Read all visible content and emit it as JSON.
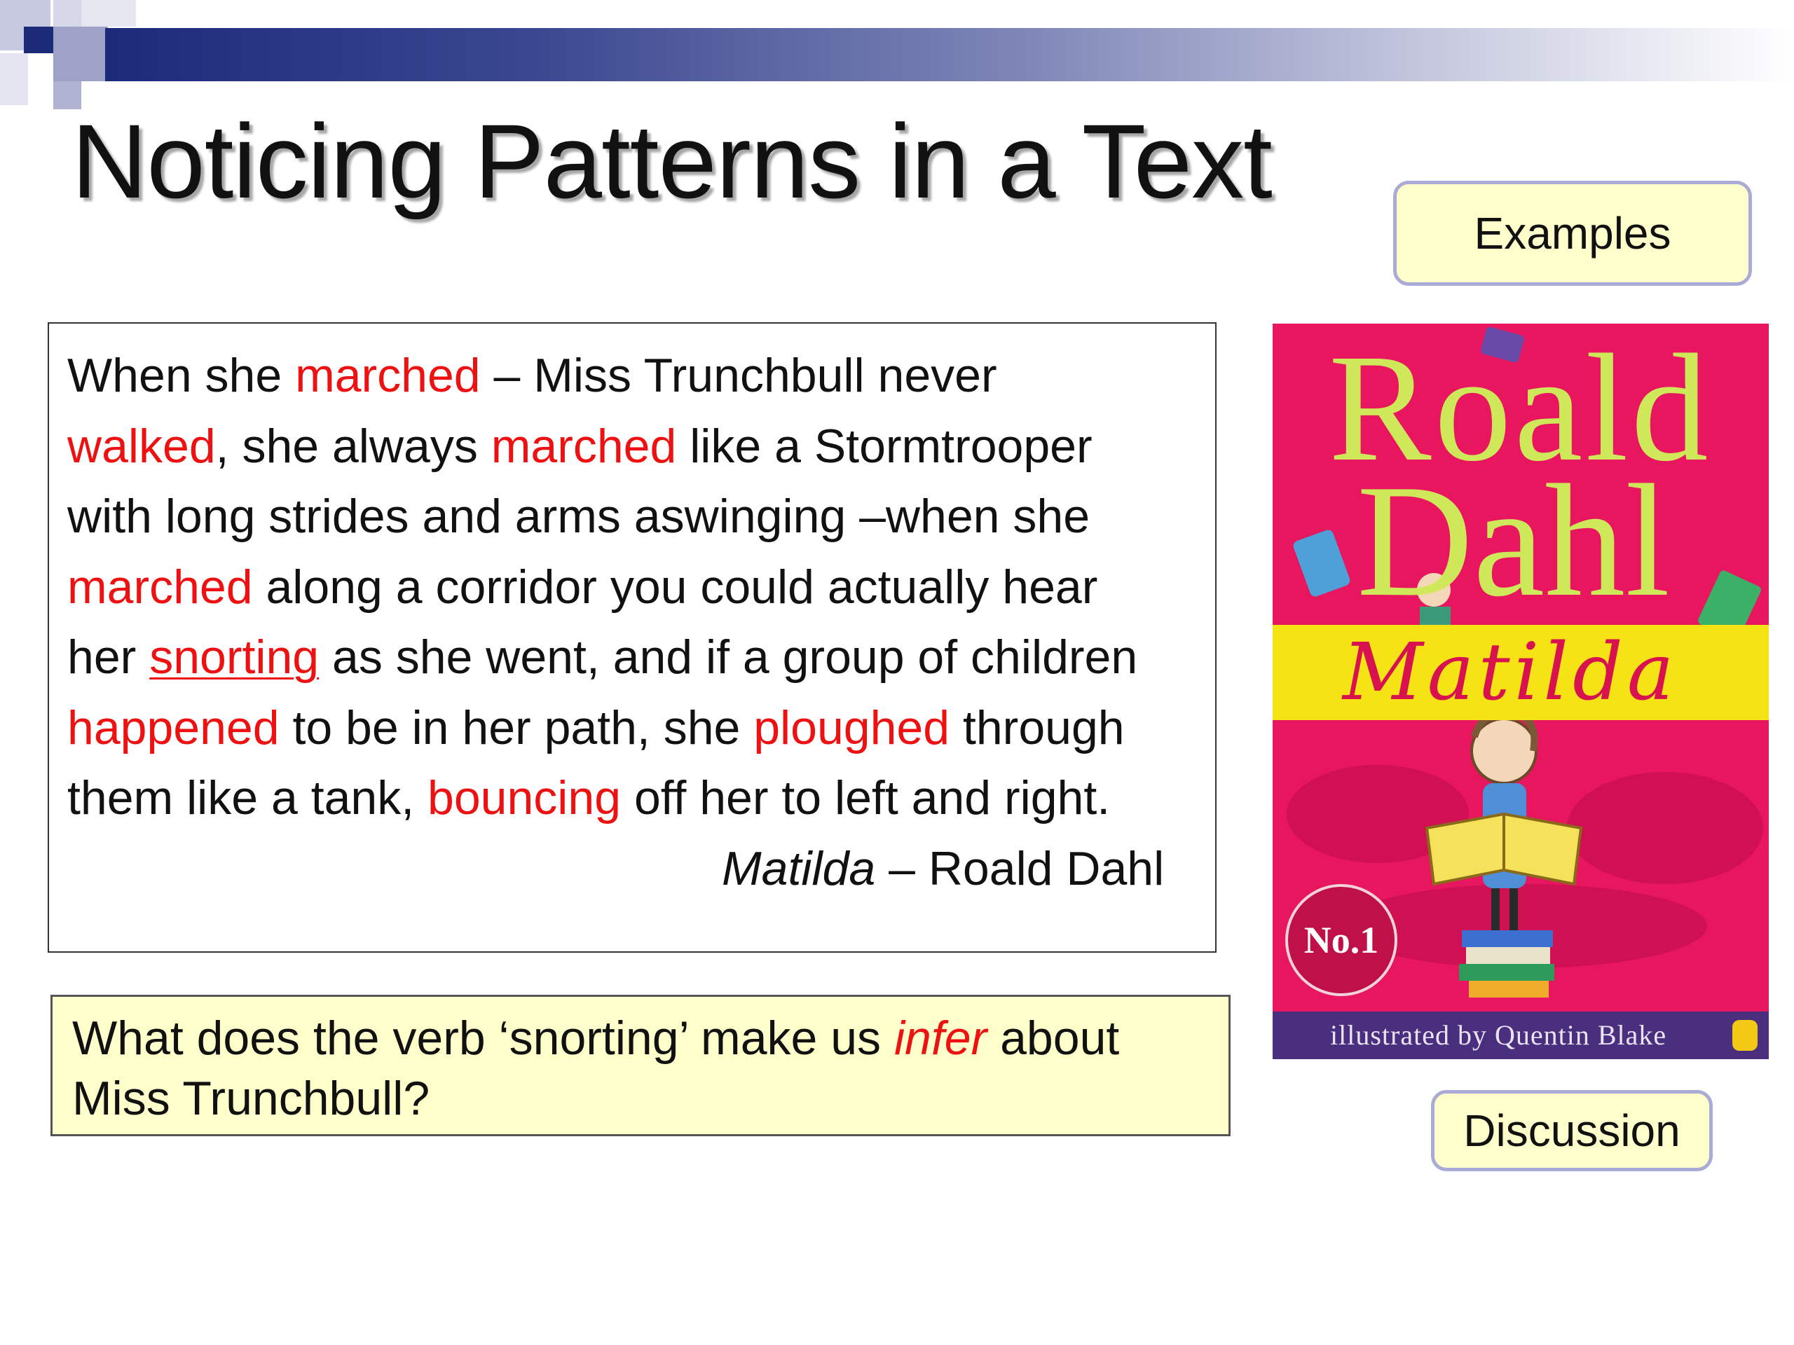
{
  "slide": {
    "title": "Noticing Patterns in a Text",
    "accent_colors": {
      "band_dark": "#1c2a7a",
      "highlight_red": "#ee1111",
      "box_yellow": "#ffffcc",
      "button_border": "#a9abd6"
    }
  },
  "buttons": {
    "examples_label": "Examples",
    "discussion_label": "Discussion"
  },
  "passage": {
    "segments": [
      {
        "text": "When she ",
        "style": "normal"
      },
      {
        "text": "marched",
        "style": "red"
      },
      {
        "text": " – Miss Trunchbull never",
        "style": "normal"
      },
      {
        "text": "\n",
        "style": "break"
      },
      {
        "text": "walked",
        "style": "red"
      },
      {
        "text": ", she always ",
        "style": "normal"
      },
      {
        "text": "marched",
        "style": "red"
      },
      {
        "text": " like a Stormtrooper",
        "style": "normal"
      },
      {
        "text": "\n",
        "style": "break"
      },
      {
        "text": "with long strides and arms aswinging –when she",
        "style": "normal"
      },
      {
        "text": "\n",
        "style": "break"
      },
      {
        "text": "marched",
        "style": "red"
      },
      {
        "text": " along a corridor you could actually hear",
        "style": "normal"
      },
      {
        "text": "\n",
        "style": "break"
      },
      {
        "text": "her ",
        "style": "normal"
      },
      {
        "text": "snorting",
        "style": "red-underline"
      },
      {
        "text": " as she went, and if a group of children",
        "style": "normal"
      },
      {
        "text": "\n",
        "style": "break"
      },
      {
        "text": "happened",
        "style": "red"
      },
      {
        "text": " to be in her path, she ",
        "style": "normal"
      },
      {
        "text": "ploughed",
        "style": "red"
      },
      {
        "text": " through",
        "style": "normal"
      },
      {
        "text": "\n",
        "style": "break"
      },
      {
        "text": "them like a tank, ",
        "style": "normal"
      },
      {
        "text": "bouncing",
        "style": "red"
      },
      {
        "text": " off her to left and right.",
        "style": "normal"
      }
    ],
    "attribution_title": "Matilda",
    "attribution_rest": " – Roald Dahl"
  },
  "question": {
    "before": "What does the verb ‘snorting’ make us ",
    "emphasis": "infer",
    "after": " about",
    "line2": "Miss Trunchbull?"
  },
  "book_cover": {
    "author_line1": "Roald",
    "author_line2": "Dahl",
    "title": "Matilda",
    "illustrator": "illustrated by Quentin Blake",
    "badge": "No.1",
    "colors": {
      "background": "#e8155f",
      "author_text": "#cfe85a",
      "title_band": "#f6e316",
      "footer": "#4a2f7e"
    }
  }
}
